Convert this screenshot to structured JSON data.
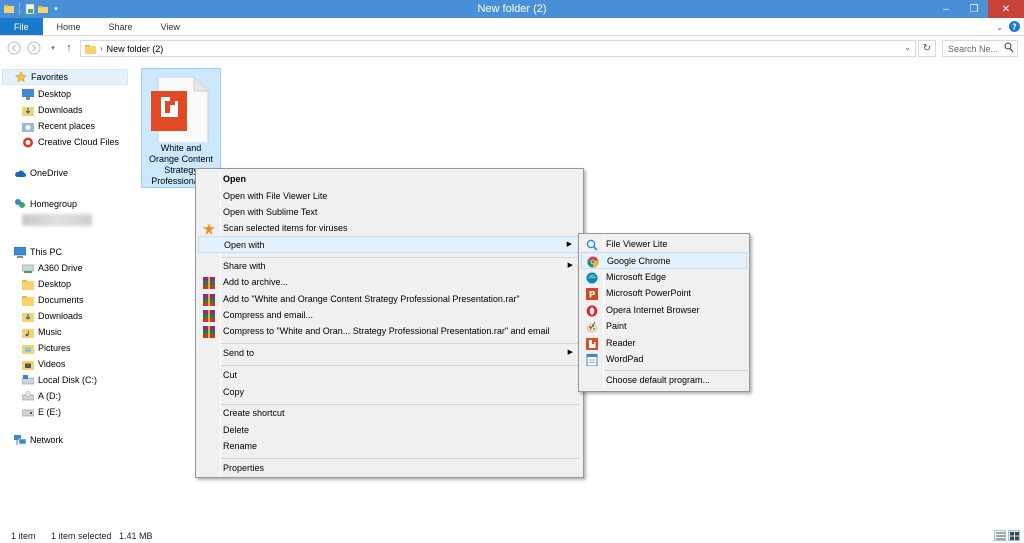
{
  "window": {
    "title": "New folder (2)"
  },
  "ribbon": {
    "tabs": [
      "File",
      "Home",
      "Share",
      "View"
    ]
  },
  "address": {
    "path": "New folder (2)"
  },
  "search": {
    "placeholder": "Search Ne..."
  },
  "navpane": {
    "favorites": "Favorites",
    "favorites_items": [
      "Desktop",
      "Downloads",
      "Recent places",
      "Creative Cloud Files"
    ],
    "onedrive": "OneDrive",
    "homegroup": "Homegroup",
    "thispc": "This PC",
    "thispc_items": [
      "A360 Drive",
      "Desktop",
      "Documents",
      "Downloads",
      "Music",
      "Pictures",
      "Videos",
      "Local Disk (C:)",
      "A (D:)",
      "E (E:)"
    ],
    "network": "Network"
  },
  "file": {
    "name_lines": [
      "White and",
      "Orange Content",
      "Strategy",
      "Professional ..."
    ],
    "icon_color": "#e04a25"
  },
  "context_menu": {
    "open": "Open",
    "open_fvl": "Open with File Viewer Lite",
    "open_sublime": "Open with Sublime Text",
    "scan": "Scan selected items for viruses",
    "open_with": "Open with",
    "share_with": "Share with",
    "add_archive": "Add to archive...",
    "add_rar": "Add to \"White and Orange Content Strategy Professional Presentation.rar\"",
    "compress_email": "Compress and email...",
    "compress_rar_email": "Compress to \"White and Oran... Strategy Professional Presentation.rar\" and email",
    "send_to": "Send to",
    "cut": "Cut",
    "copy": "Copy",
    "create_shortcut": "Create shortcut",
    "delete": "Delete",
    "rename": "Rename",
    "properties": "Properties"
  },
  "submenu": {
    "items": [
      "File Viewer Lite",
      "Google Chrome",
      "Microsoft Edge",
      "Microsoft PowerPoint",
      "Opera Internet Browser",
      "Paint",
      "Reader",
      "WordPad"
    ],
    "choose_default": "Choose default program..."
  },
  "status": {
    "count": "1 item",
    "selected": "1 item selected",
    "size": "1.41 MB"
  },
  "colors": {
    "accent": "#1979ca",
    "titlebar": "#4a90d9",
    "selection": "#cce8ff",
    "close": "#c9423a"
  }
}
